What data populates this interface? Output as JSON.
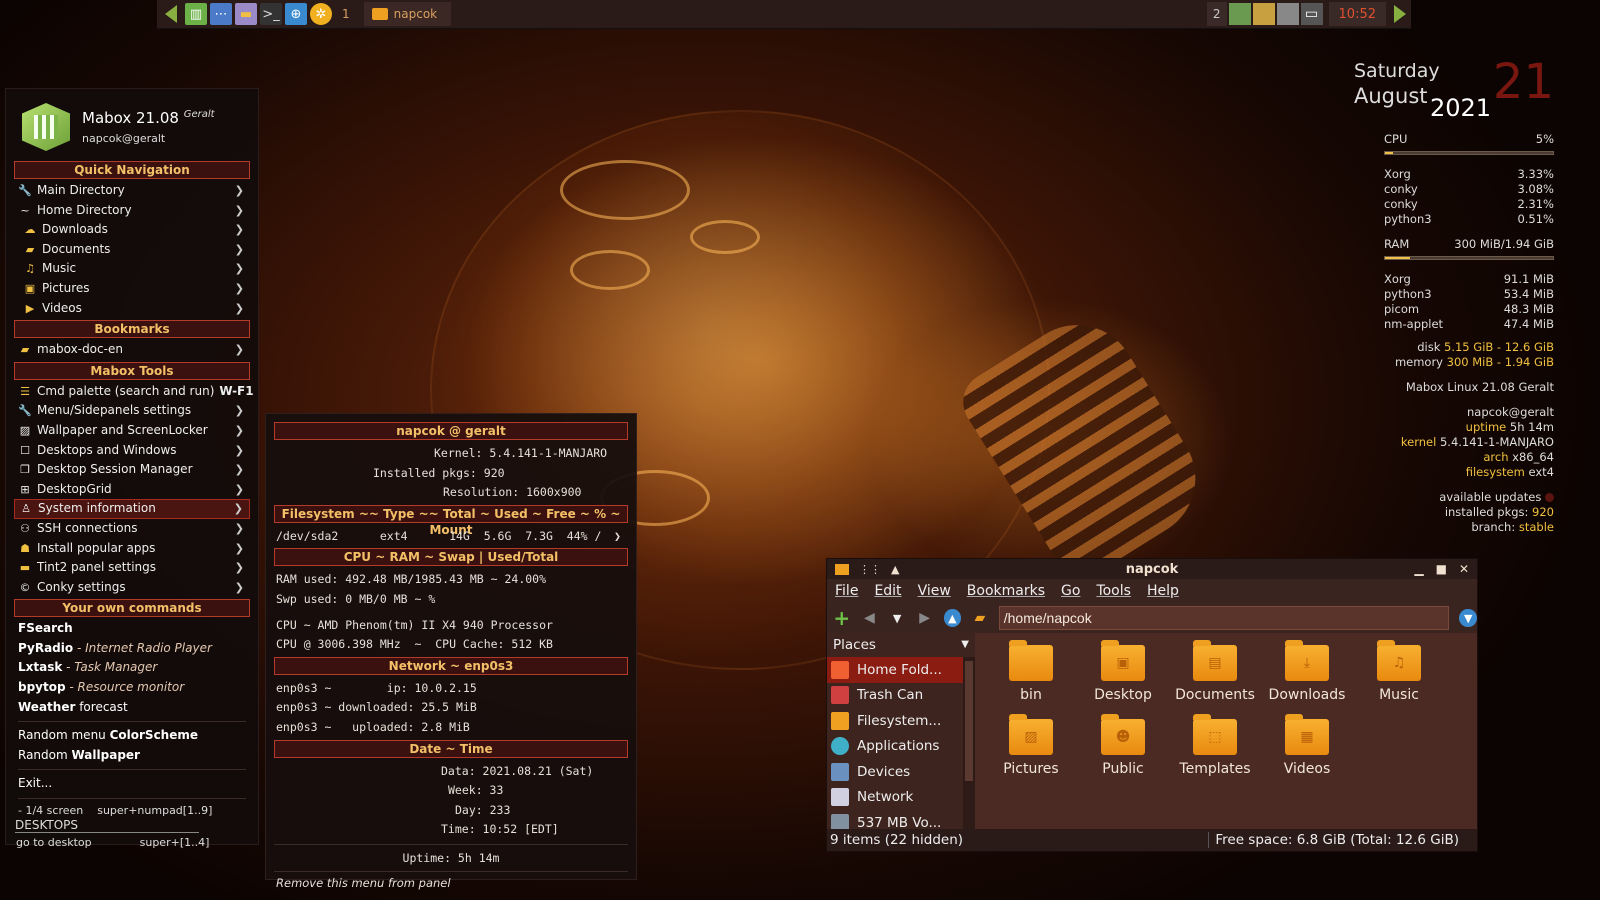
{
  "panel": {
    "workspace1": "1",
    "task_label": "napcok",
    "workspace2": "2",
    "clock": "10:52"
  },
  "menu": {
    "title": "Mabox 21.08",
    "codename": "Geralt",
    "user": "napcok@geralt",
    "sections": {
      "quick_nav": "Quick Navigation",
      "bookmarks": "Bookmarks",
      "tools": "Mabox Tools",
      "own": "Your own commands"
    },
    "nav": [
      "Main Directory",
      "Home Directory",
      "Downloads",
      "Documents",
      "Music",
      "Pictures",
      "Videos"
    ],
    "bookmark_items": [
      "mabox-doc-en"
    ],
    "tools": [
      "Cmd palette (search and run) ",
      "Menu/Sidepanels settings",
      "Wallpaper and ScreenLocker",
      "Desktops and Windows",
      "Desktop Session Manager",
      "DesktopGrid",
      "System information",
      "SSH connections",
      "Install popular apps",
      "Tint2 panel settings",
      "Conky settings"
    ],
    "cmd_palette_key": "W-F1",
    "commands": [
      {
        "name": "FSearch",
        "desc": ""
      },
      {
        "name": "PyRadio",
        "desc": " - Internet Radio Player"
      },
      {
        "name": "Lxtask",
        "desc": " - Task Manager"
      },
      {
        "name": "bpytop",
        "desc": " - Resource monitor"
      },
      {
        "name": "Weather",
        "desc": " forecast"
      }
    ],
    "random_colorscheme": "Random menu ",
    "random_colorscheme_b": "ColorScheme",
    "random_wallpaper": "Random ",
    "random_wallpaper_b": "Wallpaper",
    "exit": "Exit...",
    "hint1_l": "- 1/4 screen",
    "hint1_r": "super+numpad[1..9]",
    "desktops": "DESKTOPS",
    "hint2_l": "go to desktop",
    "hint2_r": "super+[1..4]"
  },
  "sysinfo": {
    "header": "napcok @ geralt",
    "kernel": "Kernel: 5.4.141-1-MANJARO",
    "pkgs": "Installed pkgs: 920",
    "resolution": "Resolution: 1600x900",
    "fs_header": "Filesystem ~~ Type ~~ Total ~ Used ~ Free ~ % ~ Mount",
    "fs_line": "/dev/sda2      ext4      14G  5.6G  7.3G  44% /",
    "cpu_header": "CPU ~ RAM ~ Swap | Used/Total",
    "ram": "RAM used: 492.48 MB/1985.43 MB ~ 24.00%",
    "swp": "Swp used: 0 MB/0 MB ~ %",
    "cpu_model": "CPU ~ AMD Phenom(tm) II X4 940 Processor",
    "cpu_freq": "CPU @ 3006.398 MHz  ~  CPU Cache: 512 KB",
    "net_header": "Network ~ enp0s3",
    "ip": "enp0s3 ~        ip: 10.0.2.15",
    "down": "enp0s3 ~ downloaded: 25.5 MiB",
    "up": "enp0s3 ~   uploaded: 2.8 MiB",
    "date_header": "Date ~ Time",
    "data": "Data: 2021.08.21 (Sat)",
    "week": "Week: 33",
    "day": "Day: 233",
    "time": "Time: 10:52 [EDT]",
    "uptime": "Uptime: 5h 14m",
    "remove": "Remove this menu from panel"
  },
  "fm": {
    "title": "napcok",
    "menus": [
      "File",
      "Edit",
      "View",
      "Bookmarks",
      "Go",
      "Tools",
      "Help"
    ],
    "address": "/home/napcok",
    "places_label": "Places",
    "places": [
      "Home Fold...",
      "Trash Can",
      "Filesystem...",
      "Applications",
      "Devices",
      "Network",
      "537 MB Vo..."
    ],
    "folders": [
      "bin",
      "Desktop",
      "Documents",
      "Downloads",
      "Music",
      "Pictures",
      "Public",
      "Templates",
      "Videos"
    ],
    "status_left": "9 items (22 hidden)",
    "status_right": "Free space: 6.8 GiB (Total: 12.6 GiB)"
  },
  "conky": {
    "weekday": "Saturday",
    "month": "August",
    "year": "2021",
    "daynum": "21",
    "cpu_label": "CPU",
    "cpu_pct": "5%",
    "cpu_fraction": 0.05,
    "cpu_procs": [
      [
        "Xorg",
        "3.33%"
      ],
      [
        "conky",
        "3.08%"
      ],
      [
        "conky",
        "2.31%"
      ],
      [
        "python3",
        "0.51%"
      ]
    ],
    "ram_label": "RAM",
    "ram_val": "300 MiB/1.94 GiB",
    "ram_fraction": 0.15,
    "ram_procs": [
      [
        "Xorg",
        "91.1 MiB"
      ],
      [
        "python3",
        "53.4 MiB"
      ],
      [
        "picom",
        "48.3 MiB"
      ],
      [
        "nm-applet",
        "47.4 MiB"
      ]
    ],
    "disk_label": "disk ",
    "disk_val": "5.15 GiB - 12.6 GiB",
    "mem_label": "memory ",
    "mem_val": "300 MiB - 1.94 GiB",
    "distro": "Mabox Linux 21.08 Geralt",
    "user": "napcok@geralt",
    "uptime_l": "uptime ",
    "uptime_v": "5h 14m",
    "kernel_l": "kernel ",
    "kernel_v": "5.4.141-1-MANJARO",
    "arch_l": "arch ",
    "arch_v": "x86_64",
    "fs_l": "filesystem ",
    "fs_v": "ext4",
    "updates": "available updates",
    "pkgs_l": "installed pkgs: ",
    "pkgs_v": "920",
    "branch_l": "branch: ",
    "branch_v": "stable"
  }
}
